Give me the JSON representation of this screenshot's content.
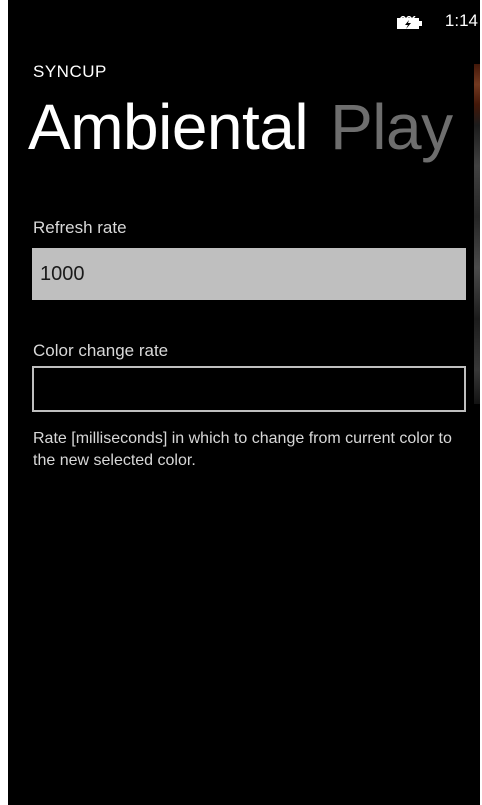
{
  "status_bar": {
    "time": "1:14",
    "battery_icon": "battery-charging-icon"
  },
  "app": {
    "title": "SYNCUP"
  },
  "pivot": {
    "items": [
      {
        "label": "Ambiental",
        "active": true
      },
      {
        "label": "Play",
        "active": false
      }
    ]
  },
  "settings": {
    "refresh_rate": {
      "label": "Refresh rate",
      "value": "1000"
    },
    "color_change_rate": {
      "label": "Color change rate",
      "value": ""
    },
    "help_text": "Rate [milliseconds] in which to change from current color to the new selected color."
  },
  "colors": {
    "background": "#000000",
    "foreground": "#ffffff",
    "inactive_pivot": "#6e6e6e",
    "input_active_bg": "#bfbfbf"
  }
}
